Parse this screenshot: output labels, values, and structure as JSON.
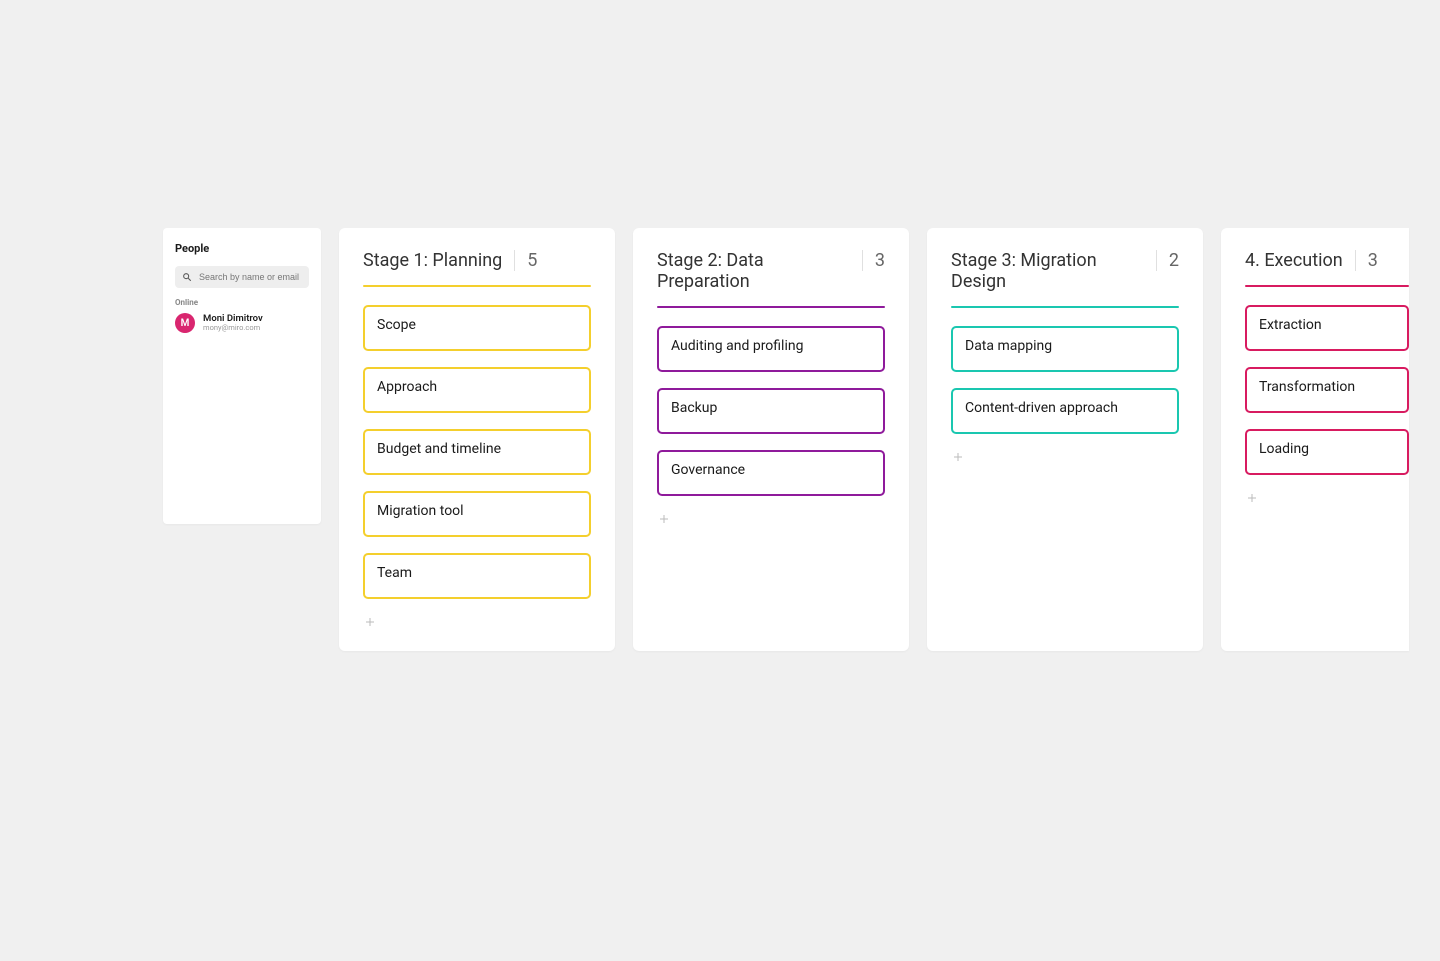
{
  "people": {
    "title": "People",
    "search_placeholder": "Search by name or email",
    "online_label": "Online",
    "user": {
      "initial": "M",
      "name": "Moni Dimitrov",
      "email": "mony@miro.com"
    }
  },
  "columns": [
    {
      "title": "Stage 1: Planning",
      "count": "5",
      "color": "#f4cf2d",
      "cards": [
        "Scope",
        "Approach",
        "Budget and timeline",
        "Migration tool",
        "Team"
      ]
    },
    {
      "title": "Stage 2: Data Preparation",
      "count": "3",
      "color": "#8f1a9b",
      "cards": [
        "Auditing and profiling",
        "Backup",
        "Governance"
      ]
    },
    {
      "title": "Stage 3: Migration Design",
      "count": "2",
      "color": "#1ac7b0",
      "cards": [
        "Data mapping",
        "Content-driven approach"
      ]
    },
    {
      "title": "4. Execution",
      "count": "3",
      "color": "#d81b60",
      "cards": [
        "Extraction",
        "Transformation",
        "Loading"
      ]
    }
  ]
}
